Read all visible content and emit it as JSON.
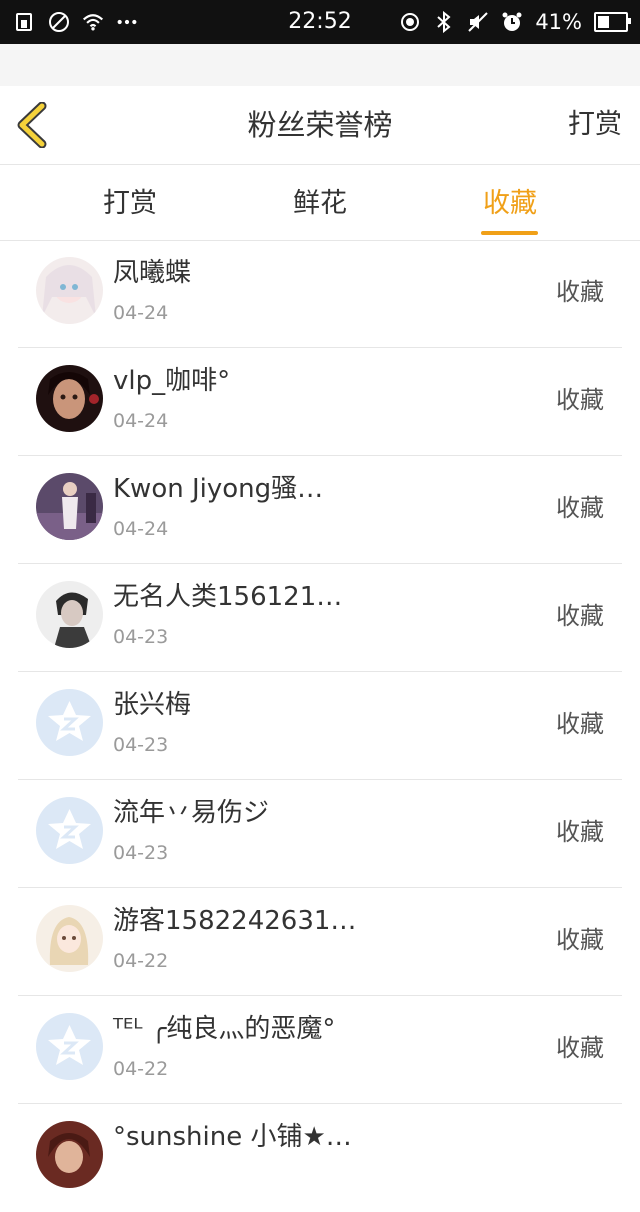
{
  "status_bar": {
    "time": "22:52",
    "battery": "41%",
    "battery_level": 0.41,
    "left_icons": [
      "sim-icon",
      "no-entry-icon",
      "wifi-icon",
      "more-icon"
    ],
    "right_icons": [
      "location-icon",
      "bluetooth-icon",
      "mute-icon",
      "alarm-icon"
    ]
  },
  "header": {
    "title": "粉丝荣誉榜",
    "right_action": "打赏",
    "back_icon": "chevron-left-icon"
  },
  "tabs": [
    {
      "label": "打赏",
      "active": false
    },
    {
      "label": "鲜花",
      "active": false
    },
    {
      "label": "收藏",
      "active": true
    }
  ],
  "colors": {
    "accent": "#f0a018",
    "back_icon_fill": "#f5d23a",
    "default_avatar": "#dce8f6"
  },
  "list": [
    {
      "name": "凤曦蝶",
      "date": "04-24",
      "action": "收藏"
    },
    {
      "name": "vlp_咖啡°",
      "date": "04-24",
      "action": "收藏"
    },
    {
      "name": "Kwon Jiyong骚…",
      "date": "04-24",
      "action": "收藏"
    },
    {
      "name": "无名人类156121…",
      "date": "04-23",
      "action": "收藏"
    },
    {
      "name": "张兴梅",
      "date": "04-23",
      "action": "收藏"
    },
    {
      "name": "流年丷易伤ジ",
      "date": "04-23",
      "action": "收藏"
    },
    {
      "name": "游客1582242631…",
      "date": "04-22",
      "action": "收藏"
    },
    {
      "name": "ᵀᴱᴸ ╭纯良灬的恶魔°",
      "date": "04-22",
      "action": "收藏"
    },
    {
      "name": "°sunshine 小铺★…",
      "date": "",
      "action": ""
    }
  ]
}
